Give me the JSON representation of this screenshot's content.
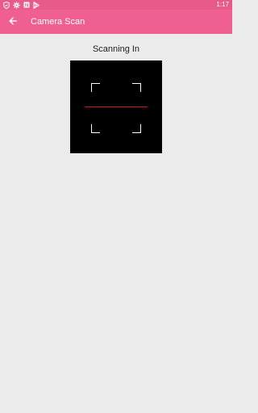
{
  "status_bar": {
    "time": "1:17",
    "icons": [
      "shield-icon",
      "settings-icon",
      "notification-icon",
      "play-store-icon"
    ]
  },
  "app_bar": {
    "title": "Camera Scan",
    "back_icon": "arrow-left-icon"
  },
  "main": {
    "heading": "Scanning In"
  },
  "colors": {
    "status_bar": "#e85a8a",
    "app_bar": "#ef5f91",
    "background": "#ebebeb",
    "camera_view": "#000000",
    "scan_line": "#c81c1c"
  }
}
